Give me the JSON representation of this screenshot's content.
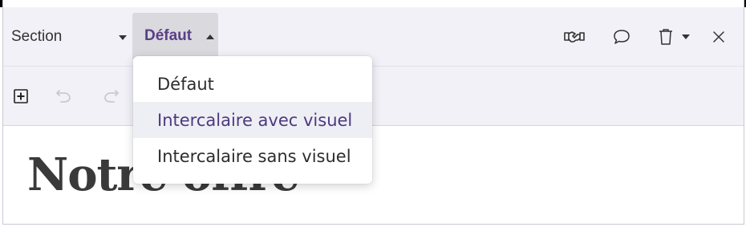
{
  "toolbar": {
    "section_label": "Section",
    "style_label": "Défaut"
  },
  "icons": {
    "handshake": "handshake-icon",
    "comment": "comment-icon",
    "trash": "trash-icon",
    "close": "close-icon",
    "add_block": "add-block-icon",
    "undo": "undo-icon",
    "redo": "redo-icon"
  },
  "content": {
    "title": "Notre offre"
  },
  "dropdown": {
    "items": [
      {
        "label": "Défaut"
      },
      {
        "label": "Intercalaire avec visuel"
      },
      {
        "label": "Intercalaire sans visuel"
      }
    ]
  },
  "colors": {
    "accent": "#5a3e86",
    "toolbar_bg": "#f1f1f7",
    "hover_bg": "#eeeef5"
  }
}
